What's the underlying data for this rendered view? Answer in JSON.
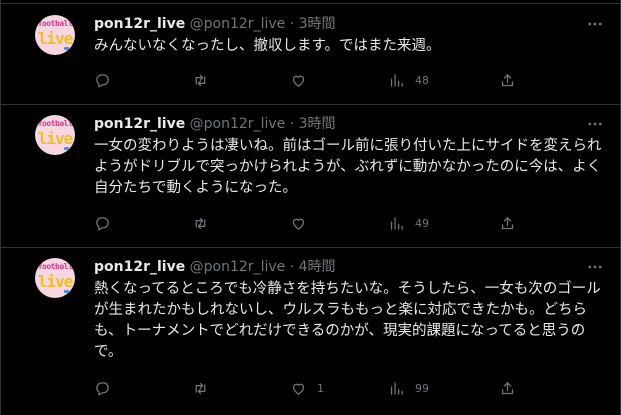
{
  "tweets": [
    {
      "display_name": "pon12r_live",
      "handle": "@pon12r_live",
      "separator": "·",
      "time": "3時間",
      "text": "みんないなくなったし、撤収します。ではまた来週。",
      "replies": "",
      "retweets": "",
      "likes": "",
      "views": "48"
    },
    {
      "display_name": "pon12r_live",
      "handle": "@pon12r_live",
      "separator": "·",
      "time": "3時間",
      "text": "一女の変わりようは凄いね。前はゴール前に張り付いた上にサイドを変えられようがドリブルで突っかけられようが、ぶれずに動かなかったのに今は、よく自分たちで動くようになった。",
      "replies": "",
      "retweets": "",
      "likes": "",
      "views": "49"
    },
    {
      "display_name": "pon12r_live",
      "handle": "@pon12r_live",
      "separator": "·",
      "time": "4時間",
      "text": "熱くなってるところでも冷静さを持ちたいな。そうしたら、一女も次のゴールが生まれたかもしれないし、ウルスラももっと楽に対応できたかも。どちらも、トーナメントでどれだけできるのかが、現実的課題になってると思うので。",
      "replies": "",
      "retweets": "",
      "likes": "1",
      "views": "99"
    }
  ],
  "avatar": {
    "top_text": "football",
    "main_text": "live"
  },
  "colors": {
    "background": "#000000",
    "text_primary": "#e7e9ea",
    "text_secondary": "#71767b",
    "divider": "#2f3336",
    "avatar_bg": "#f7d6e4"
  },
  "icons": {
    "reply": "reply-icon",
    "retweet": "retweet-icon",
    "like": "heart-icon",
    "views": "views-icon",
    "share": "share-icon",
    "more": "more-icon"
  }
}
